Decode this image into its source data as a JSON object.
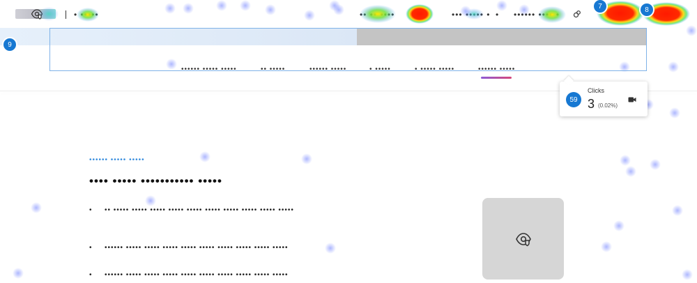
{
  "colors": {
    "accent": "#1778d2",
    "selection": "#7fb2e8",
    "eyebrow": "#3b8fde",
    "hero_gray": "#c4c4c4"
  },
  "topnav": {
    "left_dots": "• •••••",
    "items": [
      "•• •• ••••",
      "••• ••••• •",
      "•",
      "•••••• •••• •"
    ]
  },
  "subnav": [
    "•••••• ••••• •••••",
    "•• •••••",
    "•••••• •••••",
    "• •••••",
    "• ••••• •••••",
    "•••••• •••••"
  ],
  "badges": {
    "b7": "7",
    "b8": "8",
    "b9": "9"
  },
  "tooltip": {
    "badge": "59",
    "label": "Clicks",
    "count": "3",
    "percent": "(0.02%)",
    "icon": "video-camera-icon"
  },
  "content": {
    "eyebrow": "•••••• ••••• •••••",
    "heading": "•••• ••••• ••••••••••• •••••",
    "bullets": [
      "•• ••••• ••••• ••••• ••••• ••••• ••••• ••••• ••••• ••••• •••••",
      "•••••• ••••• ••••• ••••• ••••• ••••• ••••• ••••• ••••• •••••",
      "•••••• ••••• ••••• ••••• ••••• ••••• ••••• ••••• ••••• •••••"
    ],
    "bullet_marker": "•",
    "image_icon": "eye-shield-icon"
  },
  "heatmap": {
    "hotspots": [
      {
        "label": "logo",
        "level": 0.35
      },
      {
        "label": "nav-left",
        "level": 0.45
      },
      {
        "label": "nav-item-1",
        "level": 0.55
      },
      {
        "label": "nav-item-2",
        "level": 1.0
      },
      {
        "label": "nav-item-3",
        "level": 0.3
      },
      {
        "label": "nav-item-4",
        "level": 0.5
      },
      {
        "label": "cta-1",
        "level": 1.0
      },
      {
        "label": "cta-2",
        "level": 1.0
      }
    ]
  }
}
